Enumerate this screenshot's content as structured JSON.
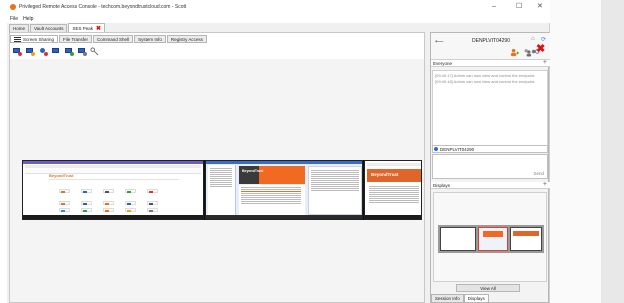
{
  "window": {
    "title": "Privileged Remote Access Console - techcom.beyondtrustcloud.com - Scott",
    "controls": {
      "minimize": "–",
      "maximize": "☐",
      "close": "✕"
    }
  },
  "menu": [
    "File",
    "Help"
  ],
  "session_tabs": [
    {
      "label": "Home",
      "active": false
    },
    {
      "label": "Vault Accounts",
      "active": false
    },
    {
      "label": "SES Peak",
      "active": true,
      "closable": true
    }
  ],
  "feature_tabs": [
    {
      "label": "Screen Sharing",
      "active": true
    },
    {
      "label": "File Transfer",
      "active": false
    },
    {
      "label": "Command Shell",
      "active": false
    },
    {
      "label": "System Info",
      "active": false
    },
    {
      "label": "Registry Access",
      "active": false
    }
  ],
  "toolbar_icons": [
    "monitor-sharing-icon",
    "monitor-control-icon",
    "user-icon",
    "monitor-display-icon",
    "monitor-multi-icon",
    "monitor-lock-icon",
    "key-icon"
  ],
  "remote_screen": {
    "monitor1_logo": "BeyondTrust",
    "monitor2_logo": "BeyondTrust",
    "monitor3_logo": "BeyondTrust"
  },
  "session_panel": {
    "endpoint_name": "DENPLVIT04290",
    "back_icon": "back-arrow-icon",
    "everyone_label": "Everyone",
    "chat_lines": [
      "[09:40:17] Admin can now view and control the endpoint.",
      "[09:40:18] Admin can now view and control the endpoint."
    ],
    "recipient": "DENPLVIT04290",
    "send_label": "Send",
    "displays_label": "Displays",
    "view_all_label": "View All",
    "bottom_tabs": [
      {
        "label": "Session Info",
        "active": false
      },
      {
        "label": "Displays",
        "active": true
      }
    ]
  },
  "colors": {
    "accent": "#e8731c",
    "close_red": "#d11111",
    "monitor_blue": "#2a62c9"
  }
}
